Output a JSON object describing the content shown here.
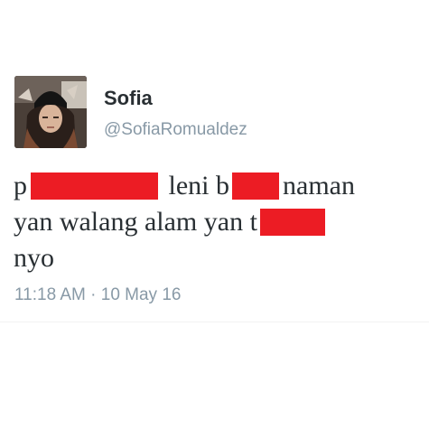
{
  "user": {
    "display_name": "Sofia",
    "handle": "@SofiaRomualdez",
    "avatar_icon": "profile-photo"
  },
  "tweet": {
    "line1": {
      "part1": "p",
      "part2": " leni b",
      "part3": "naman"
    },
    "line2": {
      "part1": "yan walang alam yan t"
    },
    "line3": {
      "part1": "nyo"
    },
    "redaction_color": "#ec1c24"
  },
  "meta": {
    "timestamp": "11:18 AM · 10 May 16"
  },
  "colors": {
    "name": "#292f33",
    "secondary": "#8899a6",
    "text": "#292f33"
  }
}
